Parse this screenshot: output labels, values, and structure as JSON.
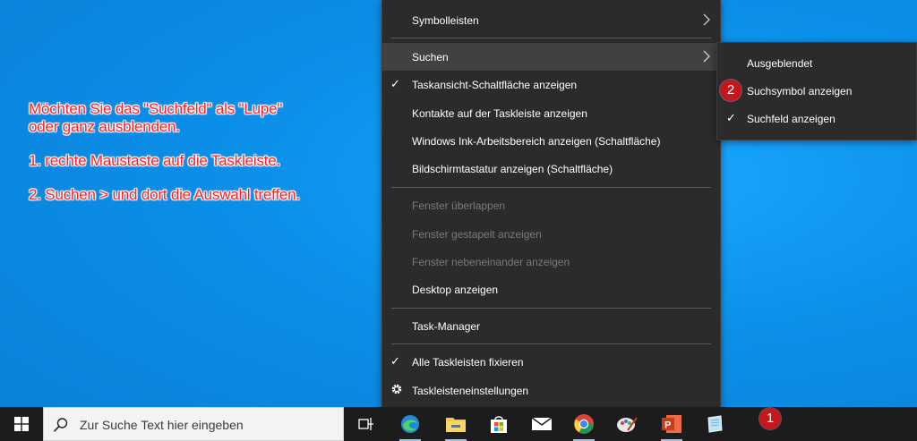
{
  "annotation": {
    "line1": "Möchten Sie das \"Suchfeld\" als \"Lupe\"",
    "line2": "oder ganz ausblenden.",
    "step1": "1. rechte Maustaste auf die Taskleiste.",
    "step2": "2. Suchen > und dort die Auswahl treffen."
  },
  "context_menu": {
    "items": [
      {
        "label": "Symbolleisten"
      },
      {
        "label": "Suchen"
      },
      {
        "label": "Taskansicht-Schaltfläche anzeigen"
      },
      {
        "label": "Kontakte auf der Taskleiste anzeigen"
      },
      {
        "label": "Windows Ink-Arbeitsbereich anzeigen (Schaltfläche)"
      },
      {
        "label": "Bildschirmtastatur anzeigen (Schaltfläche)"
      },
      {
        "label": "Fenster überlappen"
      },
      {
        "label": "Fenster gestapelt anzeigen"
      },
      {
        "label": "Fenster nebeneinander anzeigen"
      },
      {
        "label": "Desktop anzeigen"
      },
      {
        "label": "Task-Manager"
      },
      {
        "label": "Alle Taskleisten fixieren"
      },
      {
        "label": "Taskleisteneinstellungen"
      }
    ]
  },
  "submenu": {
    "items": [
      {
        "label": "Ausgeblendet"
      },
      {
        "label": "Suchsymbol anzeigen"
      },
      {
        "label": "Suchfeld anzeigen"
      }
    ]
  },
  "badges": {
    "taskbar": "1",
    "submenu": "2"
  },
  "taskbar": {
    "search_placeholder": "Zur Suche Text hier eingeben"
  },
  "colors": {
    "badge": "#c7151e",
    "annotation": "#ff2020",
    "menu_bg": "#2b2b2b",
    "desktop": "#0b8fe8"
  }
}
